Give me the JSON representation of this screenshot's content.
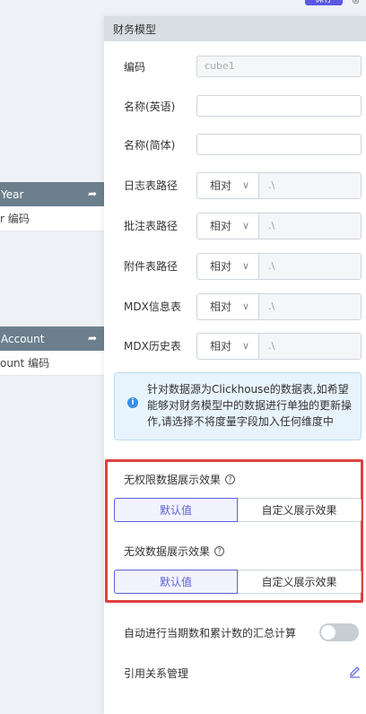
{
  "top": {
    "button_label": "保存"
  },
  "background_cards": [
    {
      "header": "Year",
      "row": "r 编码"
    },
    {
      "header": "Account",
      "row": "ount 编码"
    }
  ],
  "panel": {
    "title": "财务模型",
    "fields": {
      "code": {
        "label": "编码",
        "value": "cube1"
      },
      "name_en": {
        "label": "名称(英语)",
        "value": ""
      },
      "name_cn": {
        "label": "名称(简体)",
        "value": ""
      },
      "log_path": {
        "label": "日志表路径",
        "mode": "相对",
        "path": ".\\"
      },
      "annotation_path": {
        "label": "批注表路径",
        "mode": "相对",
        "path": ".\\"
      },
      "attachment_path": {
        "label": "附件表路径",
        "mode": "相对",
        "path": ".\\"
      },
      "mdx_info": {
        "label": "MDX信息表",
        "mode": "相对",
        "path": ".\\"
      },
      "mdx_history": {
        "label": "MDX历史表",
        "mode": "相对",
        "path": ".\\"
      }
    },
    "info_text": "针对数据源为Clickhouse的数据表,如希望能够对财务模型中的数据进行单独的更新操作,请选择不将度量字段加入任何维度中",
    "no_permission": {
      "label": "无权限数据展示效果",
      "options": [
        "默认值",
        "自定义展示效果"
      ],
      "selected": "默认值"
    },
    "invalid_data": {
      "label": "无效数据展示效果",
      "options": [
        "默认值",
        "自定义展示效果"
      ],
      "selected": "默认值"
    },
    "auto_calc": {
      "label": "自动进行当期数和累计数的汇总计算",
      "enabled": false
    },
    "reference": {
      "label": "引用关系管理"
    }
  },
  "colors": {
    "accent": "#5b5fd8",
    "highlight_border": "#e04040",
    "info_bg": "#e8f4fd",
    "card_header": "#6b7f8d"
  }
}
